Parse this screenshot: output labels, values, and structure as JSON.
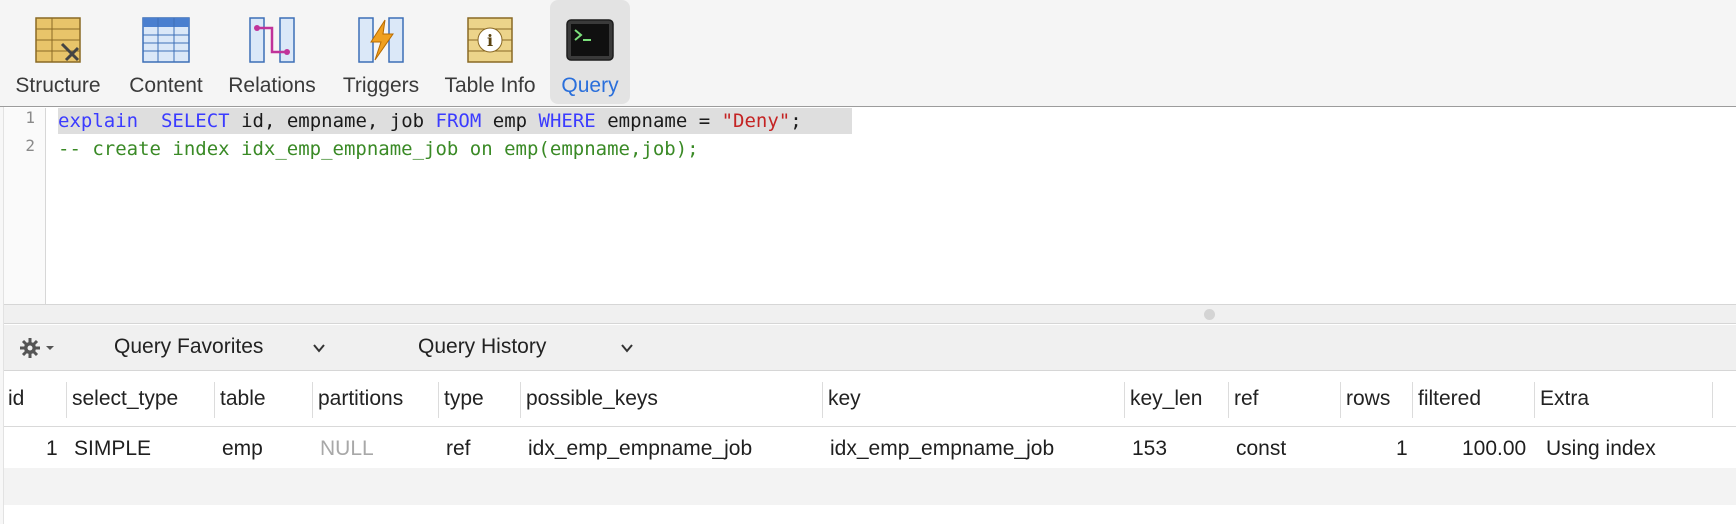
{
  "toolbar": {
    "tabs": [
      {
        "label": "Structure",
        "icon": "structure-icon"
      },
      {
        "label": "Content",
        "icon": "content-icon"
      },
      {
        "label": "Relations",
        "icon": "relations-icon"
      },
      {
        "label": "Triggers",
        "icon": "triggers-icon"
      },
      {
        "label": "Table Info",
        "icon": "table-info-icon"
      },
      {
        "label": "Query",
        "icon": "query-terminal-icon",
        "active": true
      }
    ]
  },
  "editor": {
    "lines": [
      {
        "number": "1",
        "tokens": [
          "explain",
          "SELECT",
          "id, empname, job",
          "FROM",
          "emp",
          "WHERE",
          "empname =",
          "\"Deny\"",
          ";"
        ]
      },
      {
        "number": "2",
        "text": "-- create index idx_emp_empname_job on emp(empname,job);"
      }
    ]
  },
  "query_bar": {
    "favorites_label": "Query Favorites",
    "history_label": "Query History"
  },
  "results": {
    "columns": [
      "id",
      "select_type",
      "table",
      "partitions",
      "type",
      "possible_keys",
      "key",
      "key_len",
      "ref",
      "rows",
      "filtered",
      "Extra"
    ],
    "rows": [
      [
        "1",
        "SIMPLE",
        "emp",
        "NULL",
        "ref",
        "idx_emp_empname_job",
        "idx_emp_empname_job",
        "153",
        "const",
        "1",
        "100.00",
        "Using index"
      ]
    ]
  },
  "colors": {
    "keyword": "#3b3bff",
    "string": "#c42323",
    "comment": "#3a8a26",
    "active_tab": "#2a6fdb"
  }
}
